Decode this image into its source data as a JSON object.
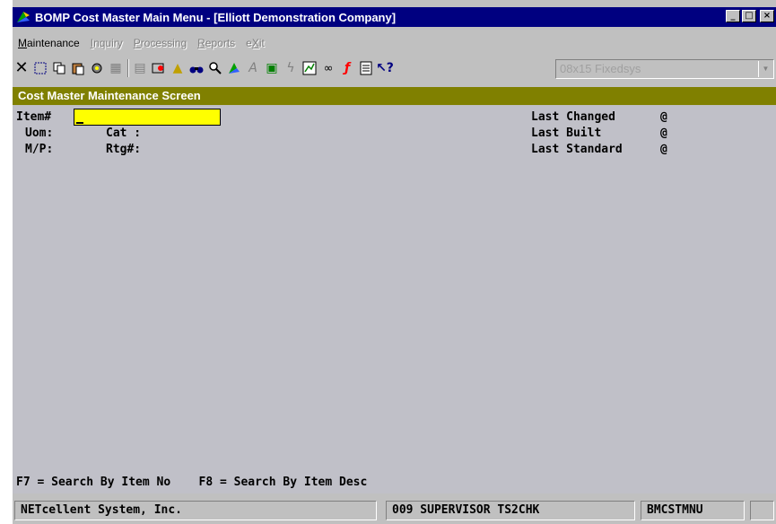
{
  "window": {
    "title": "BOMP Cost Master Main Menu - [Elliott Demonstration Company]",
    "minimize_label": "_",
    "maximize_label": "□",
    "close_label": "×"
  },
  "menu": [
    {
      "label": "Maintenance",
      "underline": "M",
      "rest": "aintenance",
      "enabled": true
    },
    {
      "label": "Inquiry",
      "underline": "I",
      "rest": "nquiry",
      "enabled": false
    },
    {
      "label": "Processing",
      "underline": "P",
      "rest": "rocessing",
      "enabled": false
    },
    {
      "label": "Reports",
      "underline": "R",
      "rest": "eports",
      "enabled": false
    },
    {
      "label": "eXit",
      "pre": "e",
      "underline": "X",
      "rest": "it",
      "enabled": false
    }
  ],
  "toolbar": {
    "font_combo_value": "08x15 Fixedsys"
  },
  "screen": {
    "header": "Cost Master Maintenance Screen",
    "item_label": "Item#",
    "uom_label": "Uom:",
    "cat_label": "Cat :",
    "mp_label": "M/P:",
    "rtg_label": "Rtg#:",
    "last_changed_label": "Last Changed",
    "last_built_label": "Last Built",
    "last_standard_label": "Last Standard",
    "at": "@",
    "item_value": "",
    "function_keys": "F7 = Search By Item No    F8 = Search By Item Desc"
  },
  "status": {
    "company": "NETcellent System, Inc.",
    "user": "009 SUPERVISOR TS2CHK",
    "program": "BMCSTMNU"
  },
  "colors": {
    "title_bar": "#000080",
    "screen_header": "#808000",
    "input_highlight": "#ffff00",
    "terminal_bg": "#c0c0c8"
  }
}
